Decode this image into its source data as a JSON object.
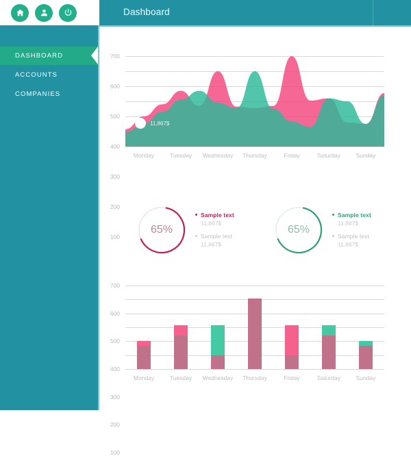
{
  "header": {
    "title": "Dashboard",
    "icons": [
      {
        "name": "home-icon",
        "label": "Home"
      },
      {
        "name": "user-icon",
        "label": "Profile"
      },
      {
        "name": "power-icon",
        "label": "Logout"
      }
    ]
  },
  "sidebar": {
    "items": [
      {
        "label": "DASHBOARD",
        "active": true
      },
      {
        "label": "ACCOUNTS",
        "active": false
      },
      {
        "label": "COMPANIES",
        "active": false
      }
    ]
  },
  "colors": {
    "teal": "#2291a2",
    "green": "#23ab87",
    "area_green": "#2cba99",
    "area_pink": "#f3467c",
    "area_overlap": "#c9687f",
    "bar_dark": "#c0728b",
    "bar_pink": "#f5608c",
    "bar_green": "#45c9a5",
    "donut_pink": "#c31c52",
    "donut_green": "#2e9e78",
    "grid": "#d8d8d8",
    "tick": "#bdbdbd"
  },
  "donuts": [
    {
      "percent": "65%",
      "percent_value": 65,
      "accent": "#c31c52",
      "track": "#f0e2e7",
      "legend": [
        {
          "title": "Sample text",
          "value": "11,867$",
          "muted": false
        },
        {
          "title": "Sample text",
          "value": "11,867$",
          "muted": true
        }
      ]
    },
    {
      "percent": "65%",
      "percent_value": 65,
      "accent": "#2e9e78",
      "track": "#e2efe9",
      "legend": [
        {
          "title": "Sample text",
          "value": "11,867$",
          "muted": false
        },
        {
          "title": "Sample text",
          "value": "11,867$",
          "muted": true
        }
      ]
    }
  ],
  "chart_data": [
    {
      "type": "area",
      "title": "",
      "xlabel": "",
      "ylabel": "",
      "categories": [
        "Monday",
        "Tuesday",
        "Wednesday",
        "Thursday",
        "Friday",
        "Saturday",
        "Sunday"
      ],
      "ylim": [
        100,
        700
      ],
      "yticks": [
        700,
        600,
        500,
        400,
        300,
        200,
        100
      ],
      "grid": true,
      "legend": "none",
      "annotation": {
        "text": "11,867$",
        "x_category": "Monday",
        "y": 255
      },
      "series": [
        {
          "name": "Pink",
          "color": "#f3467c",
          "values": [
            215,
            300,
            380,
            470,
            370,
            600,
            365,
            355,
            370,
            700,
            405,
            420,
            260,
            250,
            455
          ]
        },
        {
          "name": "Green",
          "color": "#2cba99",
          "values": [
            195,
            250,
            330,
            410,
            470,
            390,
            355,
            600,
            350,
            265,
            230,
            420,
            400,
            250,
            440
          ]
        }
      ]
    },
    {
      "type": "bar",
      "title": "",
      "xlabel": "",
      "ylabel": "",
      "categories": [
        "Monday",
        "Tuesday",
        "Wednesday",
        "Thursday",
        "Friday",
        "Saturday",
        "Sunday"
      ],
      "ylim": [
        100,
        700
      ],
      "yticks": [
        700,
        600,
        500,
        400,
        300,
        200,
        100
      ],
      "grid": true,
      "stacked": true,
      "series": [
        {
          "name": "Base",
          "color": "#c0728b",
          "values": [
            265,
            340,
            200,
            605,
            200,
            340,
            265
          ]
        },
        {
          "name": "Pink Top",
          "color": "#f5608c",
          "values": [
            300,
            415,
            0,
            0,
            415,
            0,
            0
          ]
        },
        {
          "name": "Green Top",
          "color": "#45c9a5",
          "values": [
            0,
            0,
            415,
            0,
            0,
            415,
            300
          ]
        }
      ]
    }
  ]
}
